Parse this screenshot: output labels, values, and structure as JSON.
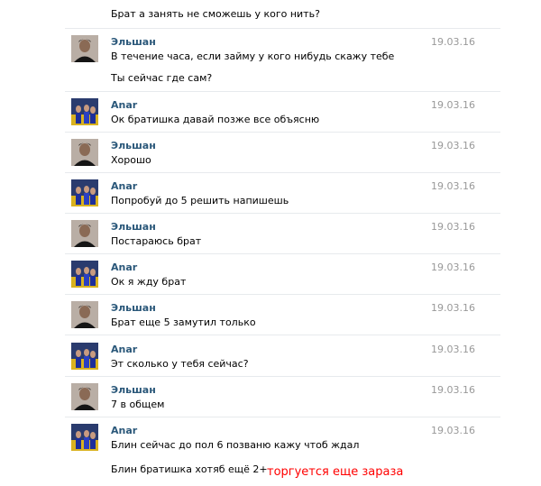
{
  "top_message": "Брат а занять не сможешь у кого нить?",
  "messages": [
    {
      "author": "Эльшан",
      "date": "19.03.16",
      "lines": [
        "В течение часа, если займу у кого нибудь скажу тебе",
        "Ты сейчас где сам?"
      ]
    },
    {
      "author": "Anar",
      "date": "19.03.16",
      "lines": [
        "Ок братишка давай позже все объясню"
      ]
    },
    {
      "author": "Эльшан",
      "date": "19.03.16",
      "lines": [
        "Хорошо"
      ]
    },
    {
      "author": "Anar",
      "date": "19.03.16",
      "lines": [
        "Попробуй до 5 решить напишешь"
      ]
    },
    {
      "author": "Эльшан",
      "date": "19.03.16",
      "lines": [
        "Постараюсь брат"
      ]
    },
    {
      "author": "Anar",
      "date": "19.03.16",
      "lines": [
        "Ок я жду брат"
      ]
    },
    {
      "author": "Эльшан",
      "date": "19.03.16",
      "lines": [
        "Брат еще 5 замутил только"
      ]
    },
    {
      "author": "Anar",
      "date": "19.03.16",
      "lines": [
        "Эт сколько у тебя сейчас?"
      ]
    },
    {
      "author": "Эльшан",
      "date": "19.03.16",
      "lines": [
        "7 в общем"
      ]
    },
    {
      "author": "Anar",
      "date": "19.03.16",
      "lines": [
        "Блин сейчас до пол 6 позваню кажу чтоб ждал",
        "Блин братишка хотяб ещё 2+"
      ]
    }
  ],
  "annotation": "торгуется еще зараза",
  "colors": {
    "author": "#2b587a",
    "date": "#999999",
    "annotation": "#ff0000"
  }
}
